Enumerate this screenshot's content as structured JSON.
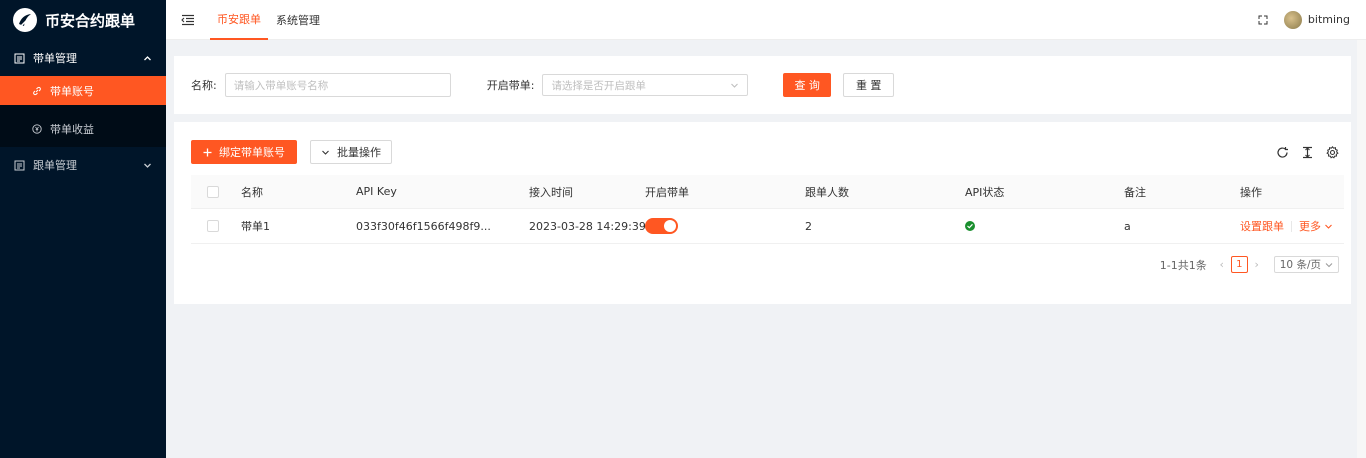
{
  "app": {
    "title": "币安合约跟单"
  },
  "sidebar": {
    "groups": [
      {
        "label": "带单管理",
        "expanded": true,
        "items": [
          {
            "label": "带单账号",
            "active": true
          },
          {
            "label": "带单收益",
            "active": false
          }
        ]
      },
      {
        "label": "跟单管理",
        "expanded": false,
        "items": []
      }
    ]
  },
  "header": {
    "tabs": [
      {
        "label": "币安跟单",
        "active": true
      },
      {
        "label": "系统管理",
        "active": false
      }
    ],
    "username": "bitming"
  },
  "search": {
    "name_label": "名称:",
    "name_placeholder": "请输入带单账号名称",
    "enabled_label": "开启带单:",
    "enabled_placeholder": "请选择是否开启跟单",
    "query_button": "查 询",
    "reset_button": "重 置"
  },
  "toolbar": {
    "bind_button": "绑定带单账号",
    "batch_button": "批量操作"
  },
  "table": {
    "columns": [
      "名称",
      "API Key",
      "接入时间",
      "开启带单",
      "跟单人数",
      "API状态",
      "备注",
      "操作"
    ],
    "rows": [
      {
        "name": "带单1",
        "api_key": "033f30f46f1566f498f9...",
        "created_at": "2023-03-28 14:29:39",
        "enabled": true,
        "followers": "2",
        "api_status": "ok",
        "remark": "a",
        "action_setup": "设置跟单",
        "action_more": "更多"
      }
    ]
  },
  "pagination": {
    "summary": "1-1共1条",
    "current_page": "1",
    "page_size": "10 条/页"
  },
  "colors": {
    "accent": "#ff5722",
    "sidebar_bg": "#001529",
    "status_ok": "#1a8f2e"
  }
}
